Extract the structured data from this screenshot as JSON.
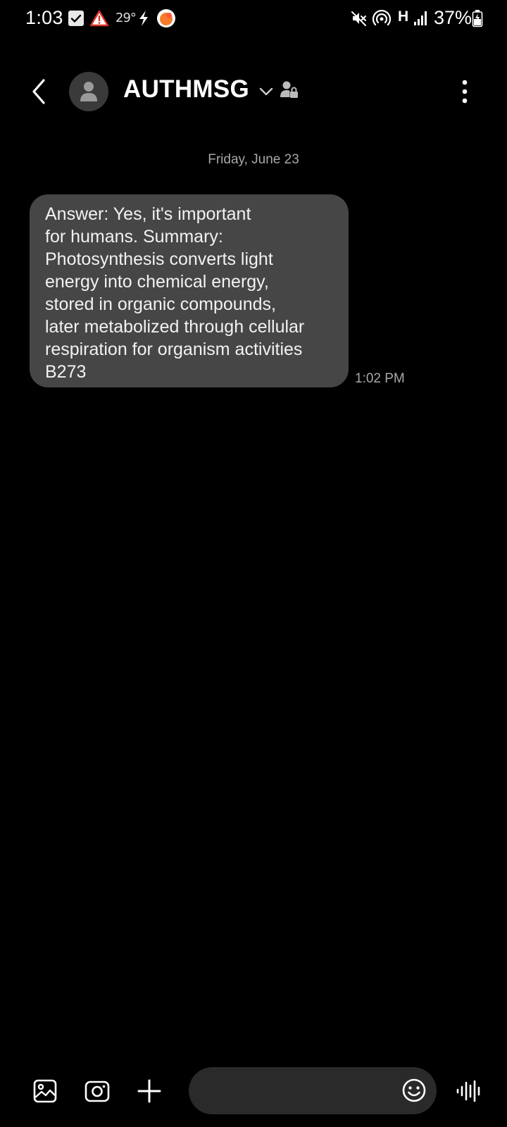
{
  "status_bar": {
    "time": "1:03",
    "temperature": "29°",
    "network_type": "H",
    "battery": "37%",
    "icons": [
      "check-notification-icon",
      "warning-icon",
      "flash-icon",
      "app-notification-icon",
      "mute-icon",
      "hotspot-icon",
      "signal-icon",
      "battery-charging-icon"
    ]
  },
  "header": {
    "contact_name": "AUTHMSG",
    "icons": [
      "back-arrow-icon",
      "avatar-person-icon",
      "chevron-down-icon",
      "contact-lock-icon",
      "more-options-icon"
    ]
  },
  "conversation": {
    "date_divider": "Friday, June 23",
    "messages": [
      {
        "direction": "incoming",
        "lines": [
          "Answer: Yes, it's important",
          "for humans. Summary:",
          "Photosynthesis converts light",
          "energy into chemical energy,",
          "stored in organic compounds,",
          "later metabolized through cellular",
          "respiration for organism activities",
          "B273"
        ],
        "time": "1:02 PM"
      }
    ]
  },
  "composer": {
    "input_value": "",
    "placeholder": "",
    "icons": [
      "gallery-icon",
      "camera-icon",
      "add-icon",
      "emoji-icon",
      "voice-record-icon"
    ]
  },
  "colors": {
    "background": "#000000",
    "bubble": "#464646",
    "secondary_text": "#a8a8a8",
    "input_background": "#2a2a2a",
    "warning_red": "#d93025",
    "notification_orange": "#f57c2a"
  }
}
